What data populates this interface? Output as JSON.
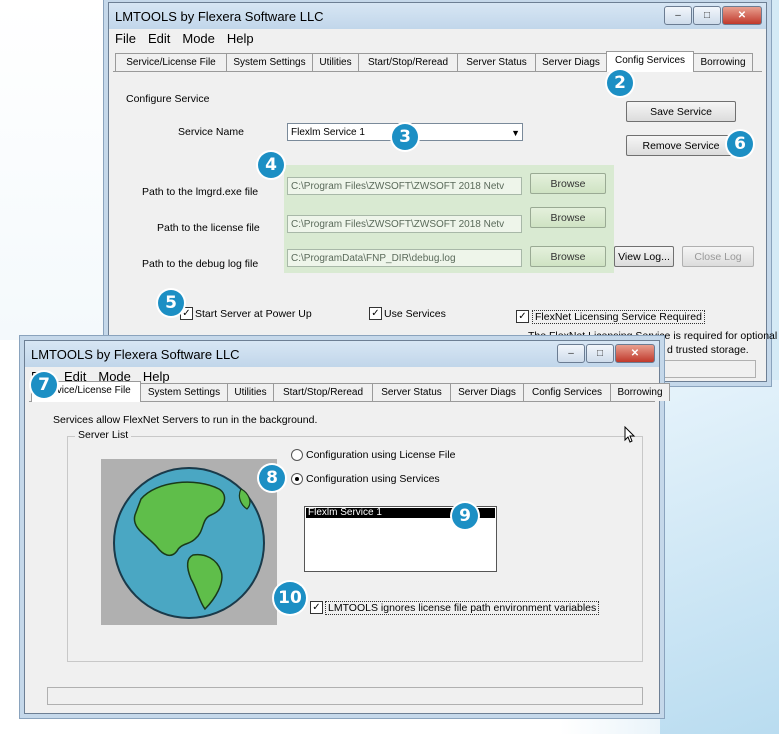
{
  "back_window": {
    "title": "LMTOOLS by Flexera Software LLC",
    "menu": [
      "File",
      "Edit",
      "Mode",
      "Help"
    ],
    "tabs": [
      "Service/License File",
      "System Settings",
      "Utilities",
      "Start/Stop/Reread",
      "Server Status",
      "Server Diags",
      "Config Services",
      "Borrowing"
    ],
    "active_tab": "Config Services",
    "configure_service_label": "Configure Service",
    "service_name_label": "Service Name",
    "service_name_value": "Flexlm Service 1",
    "lmgrd_label": "Path to the lmgrd.exe file",
    "lmgrd_value": "C:\\Program Files\\ZWSOFT\\ZWSOFT 2018 Netv",
    "license_label": "Path to the license file",
    "license_value": "C:\\Program Files\\ZWSOFT\\ZWSOFT 2018 Netv",
    "debug_label": "Path to the debug log file",
    "debug_value": "C:\\ProgramData\\FNP_DIR\\debug.log",
    "browse": "Browse",
    "save_service": "Save Service",
    "remove_service": "Remove Service",
    "view_log": "View Log...",
    "close_log": "Close Log",
    "start_server": "Start Server at Power Up",
    "use_services": "Use Services",
    "flexnet_required": "FlexNet Licensing Service Required",
    "note_line1": "The FlexNet Licensing Service is required for optional",
    "note_line2": "d trusted storage."
  },
  "front_window": {
    "title": "LMTOOLS by Flexera Software LLC",
    "menu": [
      "File",
      "Edit",
      "Mode",
      "Help"
    ],
    "tabs": [
      "Service/License File",
      "System Settings",
      "Utilities",
      "Start/Stop/Reread",
      "Server Status",
      "Server Diags",
      "Config Services",
      "Borrowing"
    ],
    "active_tab": "Service/License File",
    "info_text": "Services allow FlexNet Servers to run in the background.",
    "server_list_label": "Server List",
    "radio_license_file": "Configuration using License File",
    "radio_services": "Configuration using Services",
    "selected_service": "Flexlm Service 1",
    "ignore_env": "LMTOOLS ignores license file path environment variables"
  },
  "badges": [
    "2",
    "3",
    "4",
    "5",
    "6",
    "7",
    "8",
    "9",
    "10"
  ],
  "colors": {
    "badge": "#1c8fc4",
    "highlight": "#d9ead2",
    "ocean": "#4aa7c3",
    "land": "#5fbe4a"
  }
}
